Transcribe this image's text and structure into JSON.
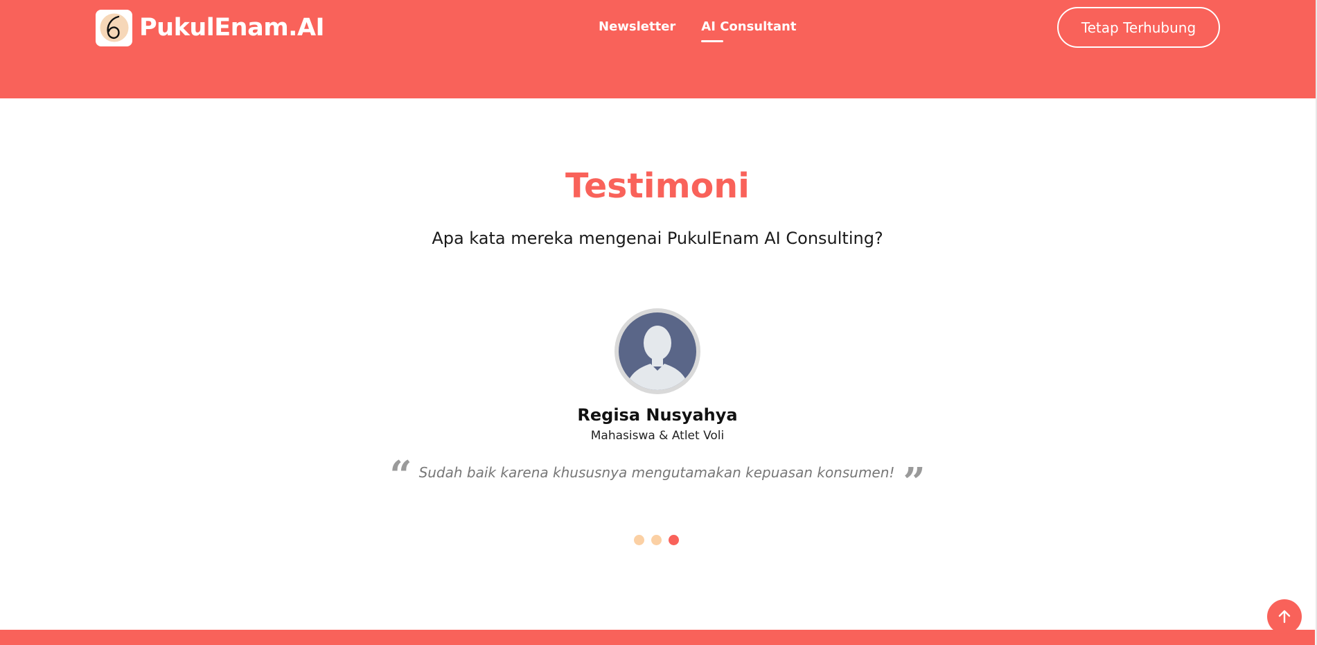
{
  "brand": {
    "name": "PukulEnam.AI",
    "logo_digit": "6",
    "logo_icon": "six-o-clock-logo-icon"
  },
  "nav": {
    "items": [
      {
        "label": "Newsletter",
        "active": false
      },
      {
        "label": "AI Consultant",
        "active": true
      }
    ]
  },
  "header": {
    "cta_label": "Tetap Terhubung"
  },
  "testimonial": {
    "title": "Testimoni",
    "subtitle": "Apa kata mereka mengenai PukulEnam AI Consulting?",
    "person": {
      "name": "Regisa Nusyahya",
      "role": "Mahasiswa & Atlet Voli",
      "avatar_icon": "default-user-avatar-icon"
    },
    "quote": "Sudah baik karena khususnya mengutamakan kepuasan konsumen!",
    "quote_open_glyph": "“",
    "quote_close_glyph": "”",
    "carousel": {
      "total": 3,
      "active_index": 2
    }
  },
  "back_to_top_icon": "arrow-up-icon",
  "colors": {
    "primary": "#f9625a",
    "dot_inactive": "#fbd0a4",
    "quote_text": "#777777",
    "avatar_bg": "#5a6688"
  }
}
